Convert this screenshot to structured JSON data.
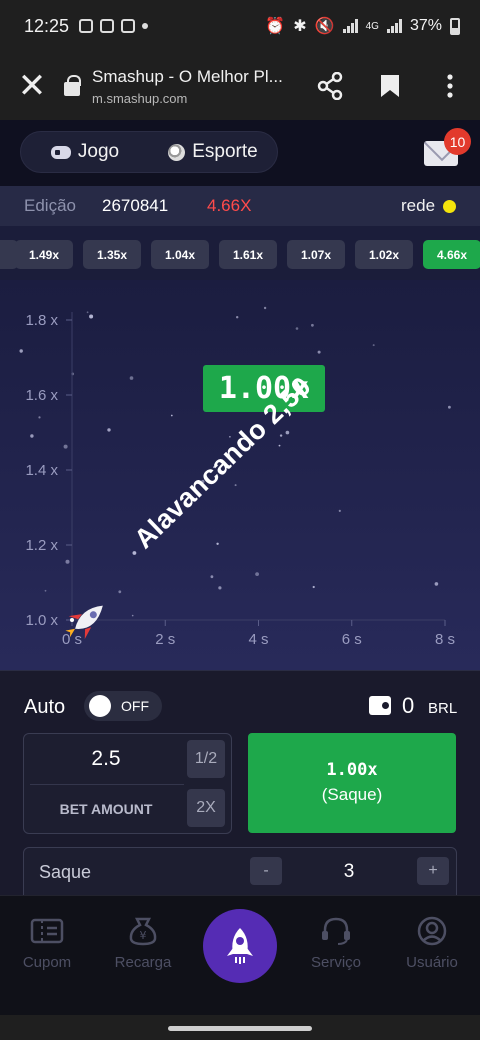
{
  "status_bar": {
    "time": "12:25",
    "network": "4G",
    "battery": "37%"
  },
  "browser": {
    "page_title": "Smashup - O Melhor Pl...",
    "url": "m.smashup.com"
  },
  "tabs": [
    {
      "label": "Jogo",
      "icon": "gamepad-icon"
    },
    {
      "label": "Esporte",
      "icon": "soccer-ball-icon"
    }
  ],
  "mail_badge": "10",
  "round_info": {
    "label": "Edição",
    "number": "2670841",
    "multiplier": "4.66X",
    "network_label": "rede"
  },
  "history": [
    "1.49x",
    "1.35x",
    "1.04x",
    "1.61x",
    "1.07x",
    "1.02x",
    "4.66x"
  ],
  "chart_data": {
    "type": "line",
    "y_ticks": [
      "1.8 x",
      "1.6 x",
      "1.4 x",
      "1.2 x",
      "1.0 x"
    ],
    "x_ticks": [
      "0 s",
      "2 s",
      "4 s",
      "6 s",
      "8 s"
    ],
    "ylim": [
      1.0,
      1.8
    ],
    "xlim": [
      0,
      8
    ],
    "series": [
      {
        "x": [
          0
        ],
        "y": [
          1.0
        ]
      }
    ]
  },
  "current_multiplier": "1.00x",
  "banner_text": "Alavancando 2,50",
  "controls": {
    "auto_label": "Auto",
    "auto_state": "OFF",
    "balance": "0",
    "currency": "BRL",
    "bet_value": "2.5",
    "bet_label": "BET AMOUNT",
    "half_label": "1/2",
    "double_label": "2X",
    "cashout_multiplier": "1.00x",
    "cashout_label": "(Saque)",
    "saque_label": "Saque",
    "saque_value": "3",
    "minus": "-",
    "plus": "+"
  },
  "bottom_nav": [
    {
      "label": "Cupom",
      "icon": "coupon-icon"
    },
    {
      "label": "Recarga",
      "icon": "money-bag-icon"
    },
    {
      "label": "",
      "icon": "rocket-icon"
    },
    {
      "label": "Serviço",
      "icon": "headset-icon"
    },
    {
      "label": "Usuário",
      "icon": "user-icon"
    }
  ],
  "colors": {
    "accent_green": "#1ea84b",
    "loss_red": "#ff4b4b",
    "nav_purple": "#552cb4"
  }
}
